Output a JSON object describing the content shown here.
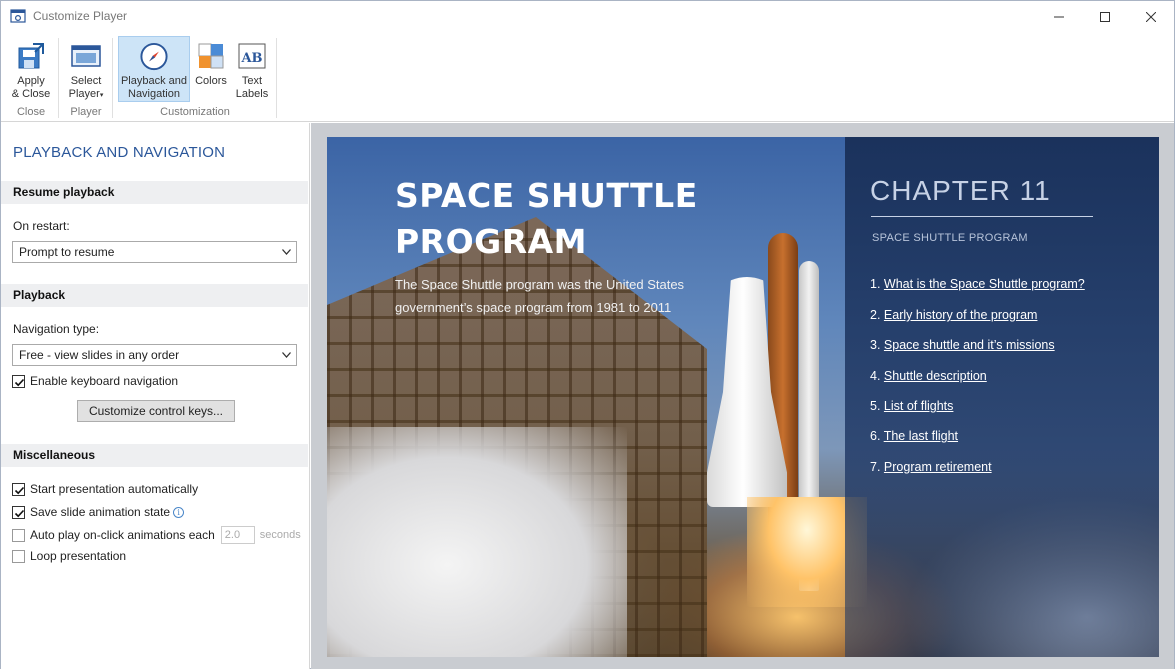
{
  "window": {
    "title": "Customize Player"
  },
  "ribbon": {
    "groups": [
      {
        "label": "Close",
        "buttons": [
          {
            "label_line1": "Apply",
            "label_line2": "& Close",
            "icon": "apply-close-icon"
          }
        ]
      },
      {
        "label": "Player",
        "buttons": [
          {
            "label_line1": "Select",
            "label_line2": "Player",
            "icon": "select-player-icon"
          }
        ]
      },
      {
        "label": "Customization",
        "buttons": [
          {
            "label_line1": "Playback and",
            "label_line2": "Navigation",
            "icon": "compass-icon",
            "active": true
          },
          {
            "label_line1": "Colors",
            "label_line2": "",
            "icon": "colors-icon"
          },
          {
            "label_line1": "Text",
            "label_line2": "Labels",
            "icon": "text-labels-icon"
          }
        ]
      }
    ]
  },
  "panel": {
    "title": "PLAYBACK AND NAVIGATION",
    "resume": {
      "heading": "Resume playback",
      "on_restart_label": "On restart:",
      "on_restart_value": "Prompt to resume"
    },
    "playback": {
      "heading": "Playback",
      "nav_type_label": "Navigation type:",
      "nav_type_value": "Free - view slides in any order",
      "keyboard_nav_label": "Enable keyboard navigation",
      "keyboard_nav_checked": true,
      "customize_keys_button": "Customize control keys..."
    },
    "misc": {
      "heading": "Miscellaneous",
      "start_auto_label": "Start presentation automatically",
      "start_auto_checked": true,
      "save_anim_label": "Save slide animation state",
      "save_anim_checked": true,
      "info_glyph": "i",
      "autoplay_label": "Auto play on-click animations each",
      "autoplay_checked": false,
      "autoplay_seconds": "2.0",
      "autoplay_unit": "seconds",
      "loop_label": "Loop presentation",
      "loop_checked": false
    }
  },
  "slide": {
    "title_line1": "SPACE SHUTTLE",
    "title_line2": "PROGRAM",
    "desc_line1": "The Space Shuttle program was the United States",
    "desc_line2": "government’s space program from 1981 to 2011",
    "chapter_title": "CHAPTER 11",
    "chapter_subtitle": "SPACE SHUTTLE PROGRAM",
    "toc": [
      {
        "num": "1.",
        "text": "What is the Space Shuttle program?"
      },
      {
        "num": "2.",
        "text": "Early history of the program"
      },
      {
        "num": "3.",
        "text": "Space shuttle and it’s missions"
      },
      {
        "num": "4.",
        "text": "Shuttle description"
      },
      {
        "num": "5.",
        "text": "List of flights"
      },
      {
        "num": "6.",
        "text": "The last flight"
      },
      {
        "num": "7.",
        "text": "Program retirement"
      }
    ]
  }
}
